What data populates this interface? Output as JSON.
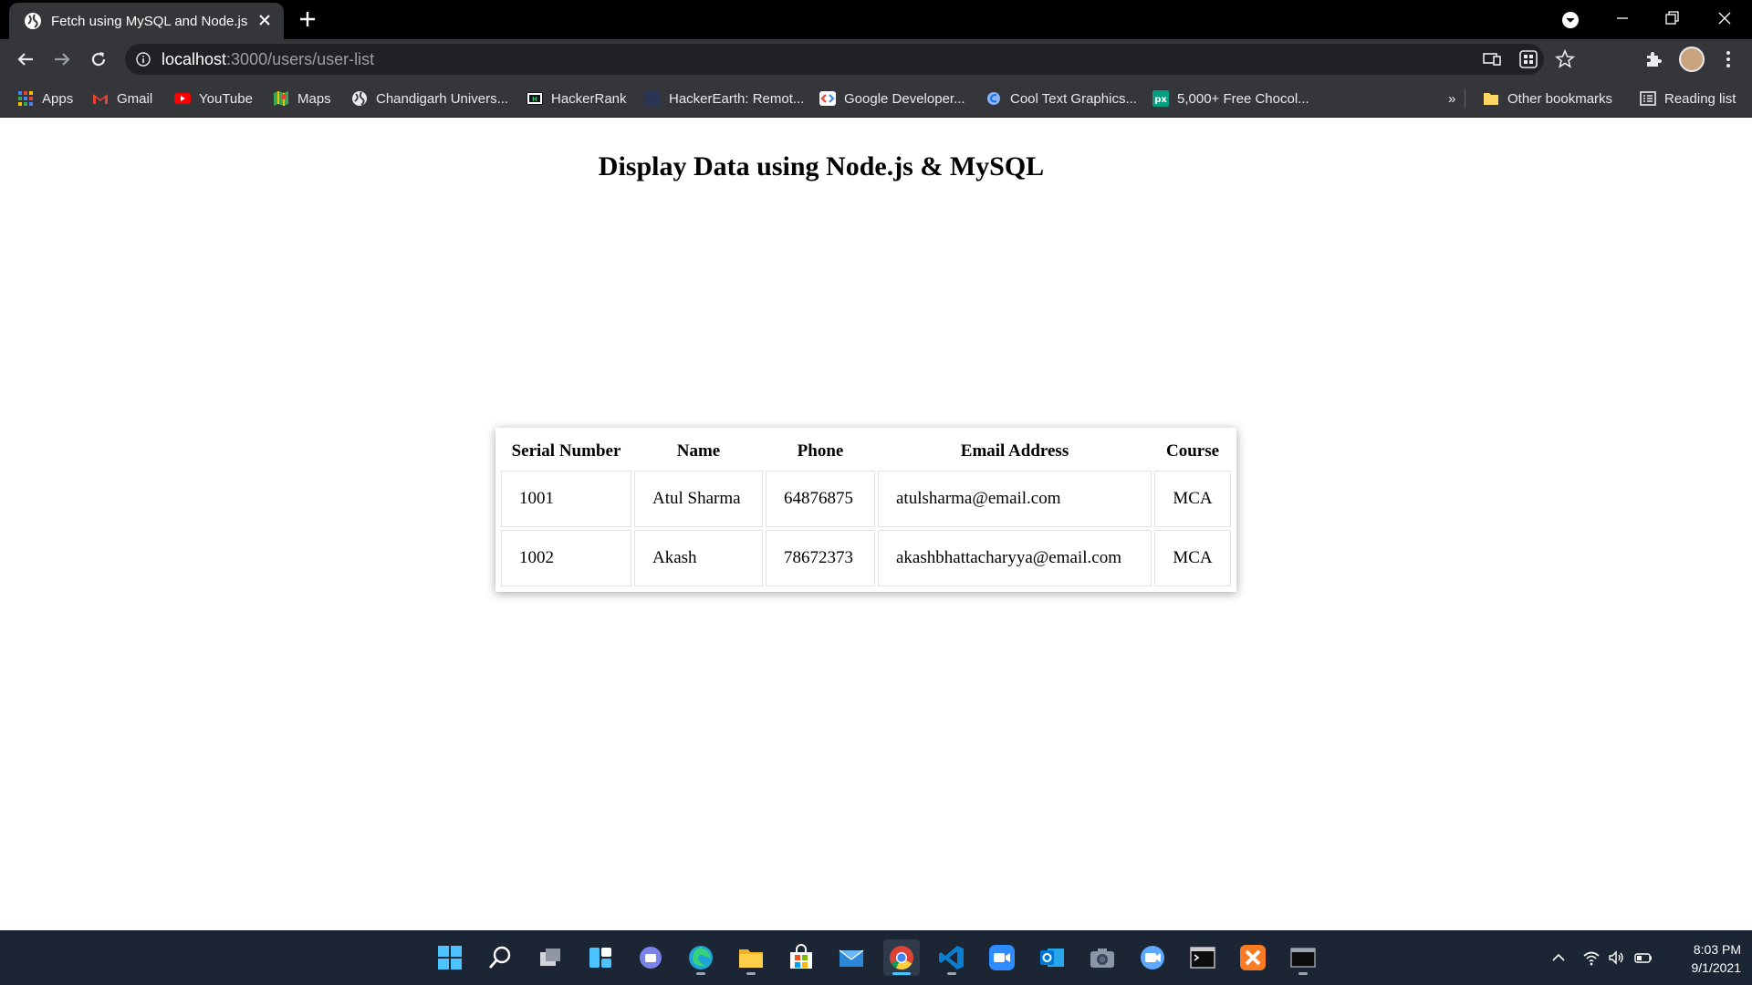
{
  "browser": {
    "tab": {
      "title": "Fetch using MySQL and Node.js"
    },
    "address": {
      "host": "localhost",
      "path": ":3000/users/user-list"
    },
    "bookmarks": [
      {
        "label": "Apps",
        "icon": "apps-grid-icon"
      },
      {
        "label": "Gmail",
        "icon": "gmail-icon"
      },
      {
        "label": "YouTube",
        "icon": "youtube-icon"
      },
      {
        "label": "Maps",
        "icon": "maps-icon"
      },
      {
        "label": "Chandigarh Univers...",
        "icon": "globe-icon"
      },
      {
        "label": "HackerRank",
        "icon": "hackerrank-icon"
      },
      {
        "label": "HackerEarth: Remot...",
        "icon": "hackerearth-icon"
      },
      {
        "label": "Google Developer...",
        "icon": "google-developers-icon"
      },
      {
        "label": "Cool Text Graphics...",
        "icon": "cooltext-icon"
      },
      {
        "label": "5,000+ Free Chocol...",
        "icon": "px-icon"
      }
    ],
    "bookmarks_overflow": "»",
    "other_bookmarks": "Other bookmarks",
    "reading_list": "Reading list"
  },
  "page": {
    "title": "Display Data using Node.js & MySQL",
    "table": {
      "headers": [
        "Serial Number",
        "Name",
        "Phone",
        "Email Address",
        "Course"
      ],
      "rows": [
        [
          "1001",
          "Atul Sharma",
          "64876875",
          "atulsharma@email.com",
          "MCA"
        ],
        [
          "1002",
          "Akash",
          "78672373",
          "akashbhattacharyya@email.com",
          "MCA"
        ]
      ]
    }
  },
  "taskbar": {
    "apps": [
      "start-icon",
      "search-icon",
      "task-view-icon",
      "widgets-icon",
      "teams-chat-icon",
      "edge-icon",
      "file-explorer-icon",
      "store-icon",
      "mail-icon",
      "chrome-icon",
      "vscode-icon",
      "zoom-icon",
      "outlook-icon",
      "camera-icon",
      "zoom-meet-icon",
      "terminal-icon",
      "xampp-icon",
      "mysql-icon"
    ],
    "time": "8:03 PM",
    "date": "9/1/2021"
  },
  "colors": {
    "tab_strip": "#000000",
    "toolbar": "#35363a",
    "omnibox": "#202124",
    "taskbar": "#1c2533",
    "accent": "#4cc2ff"
  }
}
